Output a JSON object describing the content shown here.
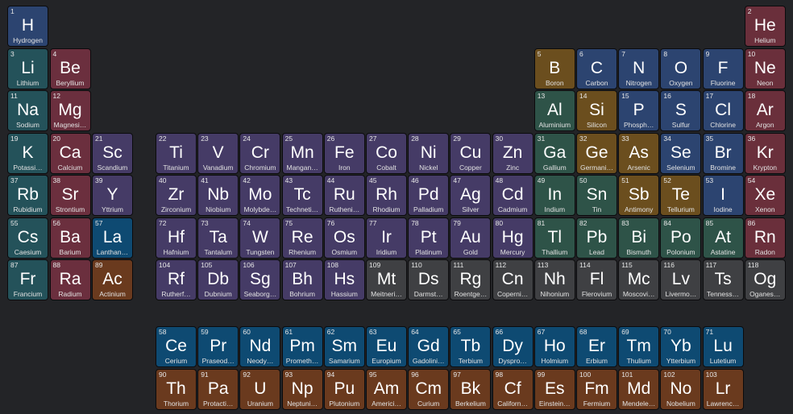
{
  "colors": {
    "background": "#232427",
    "alkali": "#24525a",
    "alkaline": "#6b2f3e",
    "transition": "#453b66",
    "post": "#2e5348",
    "metalloid": "#6b4e1e",
    "nonmetal": "#2c4470",
    "noble": "#6a2f3b",
    "lanthanide": "#0e4a72",
    "actinide": "#6a3a1e",
    "unknown": "#3f4043"
  },
  "elements": [
    {
      "n": "1",
      "s": "H",
      "name": "Hydrogen",
      "c": "nonmetal"
    },
    {
      "n": "2",
      "s": "He",
      "name": "Helium",
      "c": "noble"
    },
    {
      "n": "3",
      "s": "Li",
      "name": "Lithium",
      "c": "alkali"
    },
    {
      "n": "4",
      "s": "Be",
      "name": "Beryllium",
      "c": "alkaline"
    },
    {
      "n": "5",
      "s": "B",
      "name": "Boron",
      "c": "metalloid"
    },
    {
      "n": "6",
      "s": "C",
      "name": "Carbon",
      "c": "nonmetal"
    },
    {
      "n": "7",
      "s": "N",
      "name": "Nitrogen",
      "c": "nonmetal"
    },
    {
      "n": "8",
      "s": "O",
      "name": "Oxygen",
      "c": "nonmetal"
    },
    {
      "n": "9",
      "s": "F",
      "name": "Fluorine",
      "c": "nonmetal"
    },
    {
      "n": "10",
      "s": "Ne",
      "name": "Neon",
      "c": "noble"
    },
    {
      "n": "11",
      "s": "Na",
      "name": "Sodium",
      "c": "alkali"
    },
    {
      "n": "12",
      "s": "Mg",
      "name": "Magnesi…",
      "c": "alkaline"
    },
    {
      "n": "13",
      "s": "Al",
      "name": "Aluminium",
      "c": "post"
    },
    {
      "n": "14",
      "s": "Si",
      "name": "Silicon",
      "c": "metalloid"
    },
    {
      "n": "15",
      "s": "P",
      "name": "Phosph…",
      "c": "nonmetal"
    },
    {
      "n": "16",
      "s": "S",
      "name": "Sulfur",
      "c": "nonmetal"
    },
    {
      "n": "17",
      "s": "Cl",
      "name": "Chlorine",
      "c": "nonmetal"
    },
    {
      "n": "18",
      "s": "Ar",
      "name": "Argon",
      "c": "noble"
    },
    {
      "n": "19",
      "s": "K",
      "name": "Potassi…",
      "c": "alkali"
    },
    {
      "n": "20",
      "s": "Ca",
      "name": "Calcium",
      "c": "alkaline"
    },
    {
      "n": "21",
      "s": "Sc",
      "name": "Scandium",
      "c": "transition"
    },
    {
      "n": "22",
      "s": "Ti",
      "name": "Titanium",
      "c": "transition"
    },
    {
      "n": "23",
      "s": "V",
      "name": "Vanadium",
      "c": "transition"
    },
    {
      "n": "24",
      "s": "Cr",
      "name": "Chromium",
      "c": "transition"
    },
    {
      "n": "25",
      "s": "Mn",
      "name": "Mangan…",
      "c": "transition"
    },
    {
      "n": "26",
      "s": "Fe",
      "name": "Iron",
      "c": "transition"
    },
    {
      "n": "27",
      "s": "Co",
      "name": "Cobalt",
      "c": "transition"
    },
    {
      "n": "28",
      "s": "Ni",
      "name": "Nickel",
      "c": "transition"
    },
    {
      "n": "29",
      "s": "Cu",
      "name": "Copper",
      "c": "transition"
    },
    {
      "n": "30",
      "s": "Zn",
      "name": "Zinc",
      "c": "transition"
    },
    {
      "n": "31",
      "s": "Ga",
      "name": "Gallium",
      "c": "post"
    },
    {
      "n": "32",
      "s": "Ge",
      "name": "Germani…",
      "c": "metalloid"
    },
    {
      "n": "33",
      "s": "As",
      "name": "Arsenic",
      "c": "metalloid"
    },
    {
      "n": "34",
      "s": "Se",
      "name": "Selenium",
      "c": "nonmetal"
    },
    {
      "n": "35",
      "s": "Br",
      "name": "Bromine",
      "c": "nonmetal"
    },
    {
      "n": "36",
      "s": "Kr",
      "name": "Krypton",
      "c": "noble"
    },
    {
      "n": "37",
      "s": "Rb",
      "name": "Rubidium",
      "c": "alkali"
    },
    {
      "n": "38",
      "s": "Sr",
      "name": "Strontium",
      "c": "alkaline"
    },
    {
      "n": "39",
      "s": "Y",
      "name": "Yttrium",
      "c": "transition"
    },
    {
      "n": "40",
      "s": "Zr",
      "name": "Zirconium",
      "c": "transition"
    },
    {
      "n": "41",
      "s": "Nb",
      "name": "Niobium",
      "c": "transition"
    },
    {
      "n": "42",
      "s": "Mo",
      "name": "Molybde…",
      "c": "transition"
    },
    {
      "n": "43",
      "s": "Tc",
      "name": "Techneti…",
      "c": "transition"
    },
    {
      "n": "44",
      "s": "Ru",
      "name": "Rutheni…",
      "c": "transition"
    },
    {
      "n": "45",
      "s": "Rh",
      "name": "Rhodium",
      "c": "transition"
    },
    {
      "n": "46",
      "s": "Pd",
      "name": "Palladium",
      "c": "transition"
    },
    {
      "n": "47",
      "s": "Ag",
      "name": "Silver",
      "c": "transition"
    },
    {
      "n": "48",
      "s": "Cd",
      "name": "Cadmium",
      "c": "transition"
    },
    {
      "n": "49",
      "s": "In",
      "name": "Indium",
      "c": "post"
    },
    {
      "n": "50",
      "s": "Sn",
      "name": "Tin",
      "c": "post"
    },
    {
      "n": "51",
      "s": "Sb",
      "name": "Antimony",
      "c": "metalloid"
    },
    {
      "n": "52",
      "s": "Te",
      "name": "Tellurium",
      "c": "metalloid"
    },
    {
      "n": "53",
      "s": "I",
      "name": "Iodine",
      "c": "nonmetal"
    },
    {
      "n": "54",
      "s": "Xe",
      "name": "Xenon",
      "c": "noble"
    },
    {
      "n": "55",
      "s": "Cs",
      "name": "Caesium",
      "c": "alkali"
    },
    {
      "n": "56",
      "s": "Ba",
      "name": "Barium",
      "c": "alkaline"
    },
    {
      "n": "57",
      "s": "La",
      "name": "Lanthan…",
      "c": "lanthanide"
    },
    {
      "n": "72",
      "s": "Hf",
      "name": "Hafnium",
      "c": "transition"
    },
    {
      "n": "73",
      "s": "Ta",
      "name": "Tantalum",
      "c": "transition"
    },
    {
      "n": "74",
      "s": "W",
      "name": "Tungsten",
      "c": "transition"
    },
    {
      "n": "75",
      "s": "Re",
      "name": "Rhenium",
      "c": "transition"
    },
    {
      "n": "76",
      "s": "Os",
      "name": "Osmium",
      "c": "transition"
    },
    {
      "n": "77",
      "s": "Ir",
      "name": "Iridium",
      "c": "transition"
    },
    {
      "n": "78",
      "s": "Pt",
      "name": "Platinum",
      "c": "transition"
    },
    {
      "n": "79",
      "s": "Au",
      "name": "Gold",
      "c": "transition"
    },
    {
      "n": "80",
      "s": "Hg",
      "name": "Mercury",
      "c": "transition"
    },
    {
      "n": "81",
      "s": "Tl",
      "name": "Thallium",
      "c": "post"
    },
    {
      "n": "82",
      "s": "Pb",
      "name": "Lead",
      "c": "post"
    },
    {
      "n": "83",
      "s": "Bi",
      "name": "Bismuth",
      "c": "post"
    },
    {
      "n": "84",
      "s": "Po",
      "name": "Polonium",
      "c": "post"
    },
    {
      "n": "85",
      "s": "At",
      "name": "Astatine",
      "c": "post"
    },
    {
      "n": "86",
      "s": "Rn",
      "name": "Radon",
      "c": "noble"
    },
    {
      "n": "87",
      "s": "Fr",
      "name": "Francium",
      "c": "alkali"
    },
    {
      "n": "88",
      "s": "Ra",
      "name": "Radium",
      "c": "alkaline"
    },
    {
      "n": "89",
      "s": "Ac",
      "name": "Actinium",
      "c": "actinide"
    },
    {
      "n": "104",
      "s": "Rf",
      "name": "Rutherf…",
      "c": "transition"
    },
    {
      "n": "105",
      "s": "Db",
      "name": "Dubnium",
      "c": "transition"
    },
    {
      "n": "106",
      "s": "Sg",
      "name": "Seaborg…",
      "c": "transition"
    },
    {
      "n": "107",
      "s": "Bh",
      "name": "Bohrium",
      "c": "transition"
    },
    {
      "n": "108",
      "s": "Hs",
      "name": "Hassium",
      "c": "transition"
    },
    {
      "n": "109",
      "s": "Mt",
      "name": "Meitneri…",
      "c": "unknown"
    },
    {
      "n": "110",
      "s": "Ds",
      "name": "Darmst…",
      "c": "unknown"
    },
    {
      "n": "111",
      "s": "Rg",
      "name": "Roentge…",
      "c": "unknown"
    },
    {
      "n": "112",
      "s": "Cn",
      "name": "Coperni…",
      "c": "unknown"
    },
    {
      "n": "113",
      "s": "Nh",
      "name": "Nihonium",
      "c": "unknown"
    },
    {
      "n": "114",
      "s": "Fl",
      "name": "Flerovium",
      "c": "unknown"
    },
    {
      "n": "115",
      "s": "Mc",
      "name": "Moscovi…",
      "c": "unknown"
    },
    {
      "n": "116",
      "s": "Lv",
      "name": "Livermo…",
      "c": "unknown"
    },
    {
      "n": "117",
      "s": "Ts",
      "name": "Tenness…",
      "c": "unknown"
    },
    {
      "n": "118",
      "s": "Og",
      "name": "Oganes…",
      "c": "unknown"
    },
    {
      "n": "58",
      "s": "Ce",
      "name": "Cerium",
      "c": "lanthanide"
    },
    {
      "n": "59",
      "s": "Pr",
      "name": "Praseod…",
      "c": "lanthanide"
    },
    {
      "n": "60",
      "s": "Nd",
      "name": "Neody…",
      "c": "lanthanide"
    },
    {
      "n": "61",
      "s": "Pm",
      "name": "Prometh…",
      "c": "lanthanide"
    },
    {
      "n": "62",
      "s": "Sm",
      "name": "Samarium",
      "c": "lanthanide"
    },
    {
      "n": "63",
      "s": "Eu",
      "name": "Europium",
      "c": "lanthanide"
    },
    {
      "n": "64",
      "s": "Gd",
      "name": "Gadolini…",
      "c": "lanthanide"
    },
    {
      "n": "65",
      "s": "Tb",
      "name": "Terbium",
      "c": "lanthanide"
    },
    {
      "n": "66",
      "s": "Dy",
      "name": "Dyspro…",
      "c": "lanthanide"
    },
    {
      "n": "67",
      "s": "Ho",
      "name": "Holmium",
      "c": "lanthanide"
    },
    {
      "n": "68",
      "s": "Er",
      "name": "Erbium",
      "c": "lanthanide"
    },
    {
      "n": "69",
      "s": "Tm",
      "name": "Thulium",
      "c": "lanthanide"
    },
    {
      "n": "70",
      "s": "Yb",
      "name": "Ytterbium",
      "c": "lanthanide"
    },
    {
      "n": "71",
      "s": "Lu",
      "name": "Lutetium",
      "c": "lanthanide"
    },
    {
      "n": "90",
      "s": "Th",
      "name": "Thorium",
      "c": "actinide"
    },
    {
      "n": "91",
      "s": "Pa",
      "name": "Protacti…",
      "c": "actinide"
    },
    {
      "n": "92",
      "s": "U",
      "name": "Uranium",
      "c": "actinide"
    },
    {
      "n": "93",
      "s": "Np",
      "name": "Neptuni…",
      "c": "actinide"
    },
    {
      "n": "94",
      "s": "Pu",
      "name": "Plutonium",
      "c": "actinide"
    },
    {
      "n": "95",
      "s": "Am",
      "name": "Americi…",
      "c": "actinide"
    },
    {
      "n": "96",
      "s": "Cm",
      "name": "Curium",
      "c": "actinide"
    },
    {
      "n": "97",
      "s": "Bk",
      "name": "Berkelium",
      "c": "actinide"
    },
    {
      "n": "98",
      "s": "Cf",
      "name": "Californ…",
      "c": "actinide"
    },
    {
      "n": "99",
      "s": "Es",
      "name": "Einstein…",
      "c": "actinide"
    },
    {
      "n": "100",
      "s": "Fm",
      "name": "Fermium",
      "c": "actinide"
    },
    {
      "n": "101",
      "s": "Md",
      "name": "Mendele…",
      "c": "actinide"
    },
    {
      "n": "102",
      "s": "No",
      "name": "Nobelium",
      "c": "actinide"
    },
    {
      "n": "103",
      "s": "Lr",
      "name": "Lawrenc…",
      "c": "actinide"
    }
  ]
}
